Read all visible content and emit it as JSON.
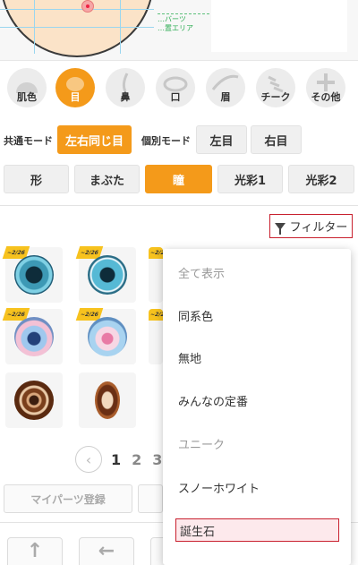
{
  "preview": {
    "area_label_line1": "…バーツ",
    "area_label_line2": "…置エリア"
  },
  "categories": [
    {
      "label": "肌色",
      "icon": "skin-icon",
      "active": false
    },
    {
      "label": "目",
      "icon": "eye-icon",
      "active": true
    },
    {
      "label": "鼻",
      "icon": "nose-icon",
      "active": false
    },
    {
      "label": "口",
      "icon": "mouth-icon",
      "active": false
    },
    {
      "label": "眉",
      "icon": "eyebrow-icon",
      "active": false
    },
    {
      "label": "チーク",
      "icon": "cheek-icon",
      "active": false
    },
    {
      "label": "その他",
      "icon": "other-icon",
      "active": false
    }
  ],
  "mode": {
    "common_label": "共通モード",
    "common_button": "左右同じ目",
    "individual_label": "個別モード",
    "left_eye": "左目",
    "right_eye": "右目"
  },
  "part_tabs": [
    "形",
    "まぶた",
    "瞳",
    "光彩1",
    "光彩2"
  ],
  "active_tab": "瞳",
  "filter": {
    "label": "フィルター",
    "options": [
      "全て表示",
      "同系色",
      "無地",
      "みんなの定番",
      "ユニーク",
      "スノーホワイト",
      "誕生石"
    ],
    "muted_options": [
      "全て表示",
      "ユニーク"
    ],
    "highlighted_option": "誕生石"
  },
  "items": {
    "badge_text": "~2/26",
    "visible_count": 8
  },
  "pagination": {
    "prev_symbol": "‹",
    "pages": [
      "1",
      "2",
      "3"
    ],
    "current": "1"
  },
  "bottom": {
    "my_parts_button": "マイパーツ登録",
    "arrows": [
      "↑",
      "←",
      "→",
      "+"
    ]
  },
  "colors": {
    "accent": "#f49a1a",
    "highlight_border": "#c8202e",
    "highlight_fill": "#fde9ec",
    "badge": "#f7c21e"
  }
}
